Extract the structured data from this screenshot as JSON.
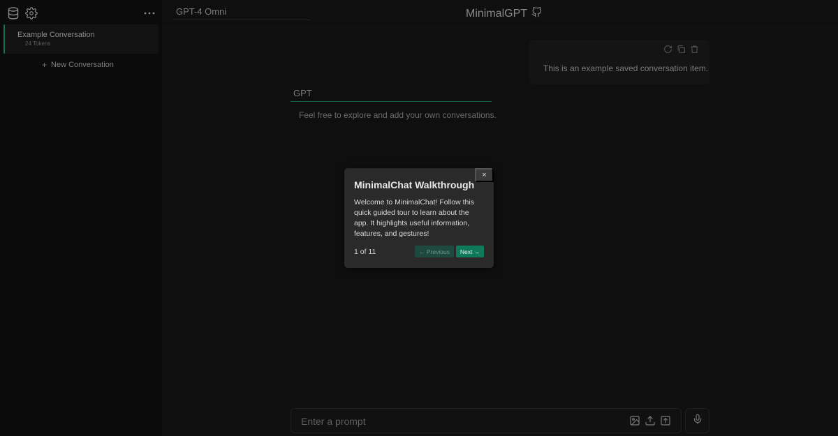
{
  "sidebar": {
    "icons": [
      "database-icon",
      "gear-icon",
      "more-options-icon"
    ],
    "conversations": [
      {
        "title": "Example Conversation",
        "tokens": "24 Tokens"
      }
    ],
    "new_conversation_label": "New Conversation"
  },
  "header": {
    "model_value": "GPT-4 Omni",
    "app_title": "MinimalGPT",
    "app_title_icon": "github-icon"
  },
  "chat": {
    "user_message": "This is an example saved conversation item.",
    "user_message_actions": [
      "regenerate-icon",
      "copy-icon",
      "delete-icon"
    ],
    "assistant_label": "GPT",
    "assistant_message": "Feel free to explore and add your own conversations."
  },
  "prompt": {
    "placeholder": "Enter a prompt",
    "icons": [
      "image-upload-icon",
      "file-upload-icon",
      "send-icon",
      "microphone-icon"
    ]
  },
  "walkthrough": {
    "close_label": "×",
    "title": "MinimalChat Walkthrough",
    "body": "Welcome to MinimalChat! Follow this quick guided tour to learn about the app. It highlights useful information, features, and gestures!",
    "progress": "1 of 11",
    "prev_label": "← Previous",
    "next_label": "Next →"
  },
  "colors": {
    "accent": "#0f7a59",
    "background": "#0f0f0f",
    "popover_bg": "#2a2a2a"
  }
}
